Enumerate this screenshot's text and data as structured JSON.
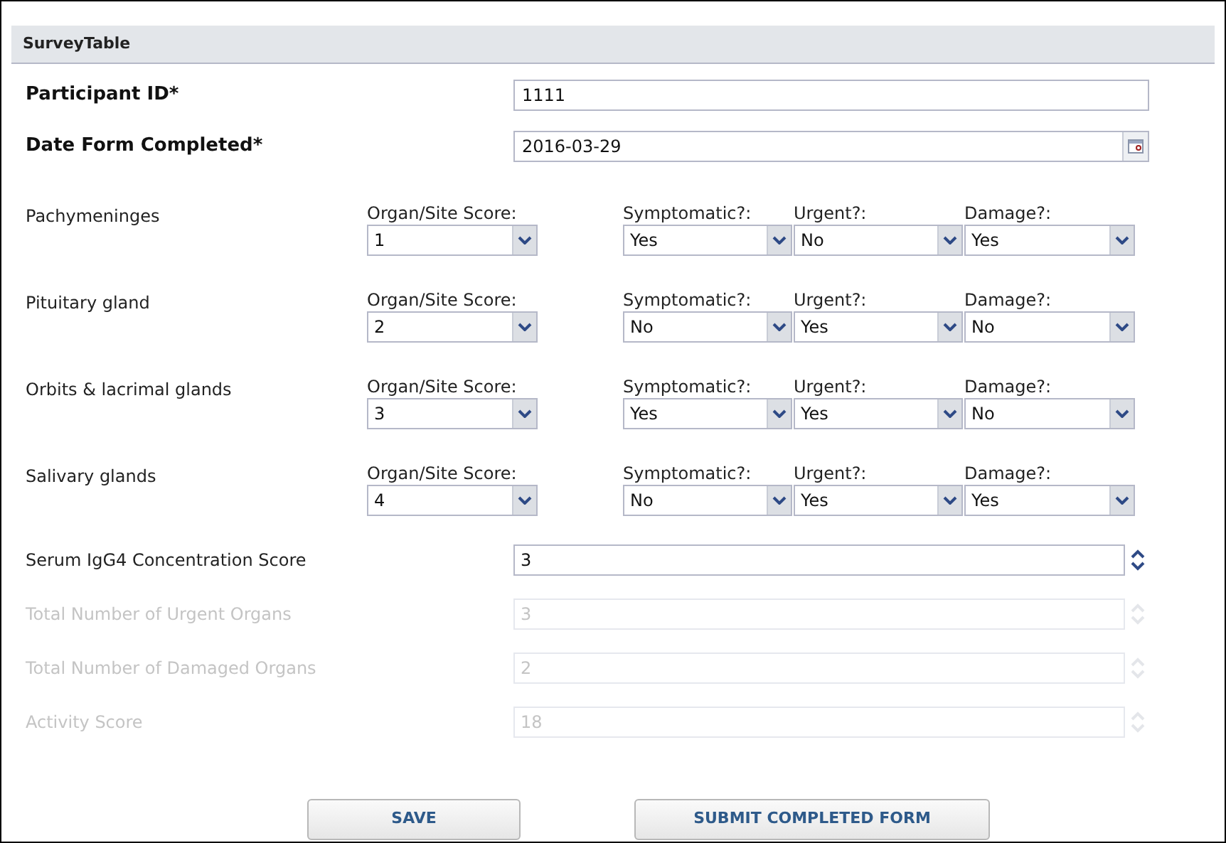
{
  "panel": {
    "title": "SurveyTable"
  },
  "top_fields": [
    {
      "label": "Participant ID*",
      "kind": "text",
      "value": "1111"
    },
    {
      "label": "Date Form Completed*",
      "kind": "date",
      "value": "2016-03-29"
    }
  ],
  "organs": [
    {
      "name": "Pachymeninges",
      "selects": [
        {
          "label": "Organ/Site Score:",
          "value": "1"
        },
        {
          "label": "Symptomatic?:",
          "value": "Yes"
        },
        {
          "label": "Urgent?:",
          "value": "No"
        },
        {
          "label": "Damage?:",
          "value": "Yes"
        }
      ]
    },
    {
      "name": "Pituitary gland",
      "selects": [
        {
          "label": "Organ/Site Score:",
          "value": "2"
        },
        {
          "label": "Symptomatic?:",
          "value": "No"
        },
        {
          "label": "Urgent?:",
          "value": "Yes"
        },
        {
          "label": "Damage?:",
          "value": "No"
        }
      ]
    },
    {
      "name": "Orbits & lacrimal glands",
      "selects": [
        {
          "label": "Organ/Site Score:",
          "value": "3"
        },
        {
          "label": "Symptomatic?:",
          "value": "Yes"
        },
        {
          "label": "Urgent?:",
          "value": "Yes"
        },
        {
          "label": "Damage?:",
          "value": "No"
        }
      ]
    },
    {
      "name": "Salivary glands",
      "selects": [
        {
          "label": "Organ/Site Score:",
          "value": "4"
        },
        {
          "label": "Symptomatic?:",
          "value": "No"
        },
        {
          "label": "Urgent?:",
          "value": "Yes"
        },
        {
          "label": "Damage?:",
          "value": "Yes"
        }
      ]
    }
  ],
  "score_fields": [
    {
      "label": "Serum IgG4 Concentration Score",
      "value": "3",
      "disabled": false
    },
    {
      "label": "Total Number of Urgent Organs",
      "value": "3",
      "disabled": true
    },
    {
      "label": "Total Number of Damaged Organs",
      "value": "2",
      "disabled": true
    },
    {
      "label": "Activity Score",
      "value": "18",
      "disabled": true
    }
  ],
  "buttons": [
    "SAVE",
    "SUBMIT COMPLETED FORM"
  ]
}
